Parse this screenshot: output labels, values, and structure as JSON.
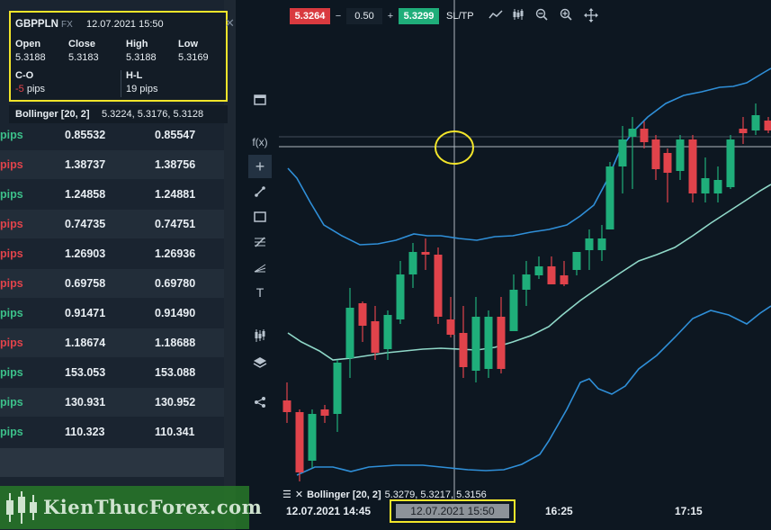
{
  "info_box": {
    "symbol": "GBPPLN",
    "type": "FX",
    "datetime": "12.07.2021 15:50",
    "open_label": "Open",
    "open": "5.3188",
    "close_label": "Close",
    "close": "5.3183",
    "high_label": "High",
    "high": "5.3188",
    "low_label": "Low",
    "low": "5.3169",
    "co_label": "C-O",
    "co_num": "-5",
    "co_unit": " pips",
    "hl_label": "H-L",
    "hl": "19 pips"
  },
  "bollinger_popup": {
    "label": "Bollinger [20, 2]",
    "values": "5.3224, 5.3176, 5.3128"
  },
  "quotes": [
    {
      "pips": "pips",
      "bid": "0.85532",
      "ask": "0.85547",
      "pips_color": "green"
    },
    {
      "pips": "pips",
      "bid": "1.38737",
      "ask": "1.38756",
      "pips_color": "red"
    },
    {
      "pips": "pips",
      "bid": "1.24858",
      "ask": "1.24881",
      "pips_color": "green"
    },
    {
      "pips": "pips",
      "bid": "0.74735",
      "ask": "0.74751",
      "pips_color": "red"
    },
    {
      "pips": "pips",
      "bid": "1.26903",
      "ask": "1.26936",
      "pips_color": "red"
    },
    {
      "pips": "pips",
      "bid": "0.69758",
      "ask": "0.69780",
      "pips_color": "red"
    },
    {
      "pips": "pips",
      "bid": "0.91471",
      "ask": "0.91490",
      "pips_color": "green"
    },
    {
      "pips": "pips",
      "bid": "1.18674",
      "ask": "1.18688",
      "pips_color": "red"
    },
    {
      "pips": "pips",
      "bid": "153.053",
      "ask": "153.088",
      "pips_color": "green"
    },
    {
      "pips": "pips",
      "bid": "130.931",
      "ask": "130.952",
      "pips_color": "green"
    },
    {
      "pips": "pips",
      "bid": "110.323",
      "ask": "110.341",
      "pips_color": "green"
    }
  ],
  "order_bar": {
    "sell_price": "5.3264",
    "minus": "−",
    "quantity": "0.50",
    "plus": "+",
    "buy_price": "5.3299",
    "sltp": "SL/TP",
    "icons": [
      "line-chart-icon",
      "candles-icon",
      "zoom-out-icon",
      "zoom-in-icon",
      "move-icon"
    ]
  },
  "toolbar_icons": [
    "window-icon",
    "function-icon",
    "crosshair-icon",
    "trendline-icon",
    "rectangle-icon",
    "fibonacci-icon",
    "pitchfork-icon",
    "text-icon",
    "indicator-icon",
    "layers-icon",
    "share-icon"
  ],
  "bollinger_bottom": {
    "label": "Bollinger [20, 2]",
    "values": "5.3279, 5.3217, 5.3156"
  },
  "x_axis": {
    "start": "12.07.2021 14:45",
    "crosshair": "12.07.2021 15:50",
    "t1": "16:25",
    "t2": "17:15"
  },
  "watermark": "KienThucForex.com",
  "colors": {
    "up": "#1fae7a",
    "down": "#e0434b",
    "band": "#2f8fd8",
    "middle": "#8fd8c8",
    "highlight": "#f2e52a"
  },
  "chart_data": {
    "type": "candlestick",
    "series": [
      {
        "name": "GBPPLN",
        "values": []
      }
    ],
    "indicators": [
      "Bollinger [20, 2]"
    ]
  }
}
